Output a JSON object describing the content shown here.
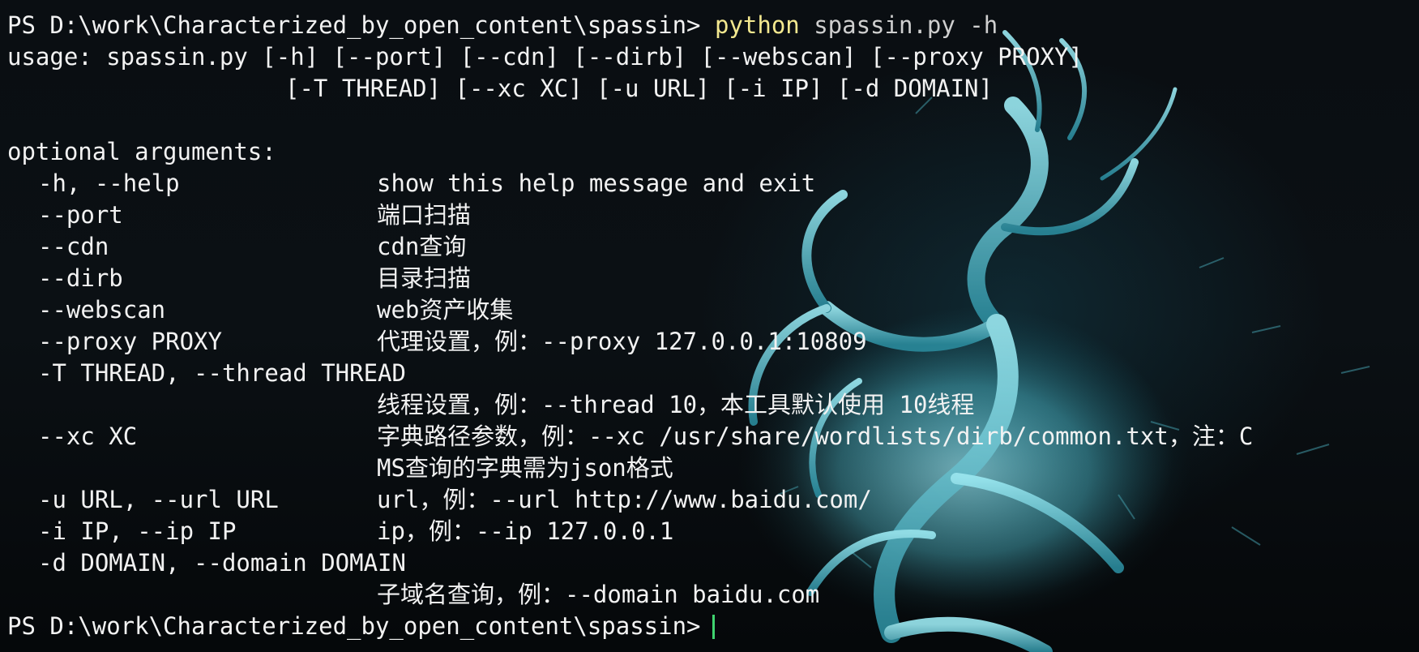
{
  "terminal": {
    "prompt_path": "PS D:\\work\\Characterized_by_open_content\\spassin>",
    "command": "python",
    "command_args": "spassin.py -h",
    "usage_line1": "usage: spassin.py [-h] [--port] [--cdn] [--dirb] [--webscan] [--proxy PROXY]",
    "usage_line2": "[-T THREAD] [--xc XC] [-u URL] [-i IP] [-d DOMAIN]",
    "section_title": "optional arguments:",
    "options": [
      {
        "name": "-h, --help",
        "desc": "show this help message and exit"
      },
      {
        "name": "--port",
        "desc": "端口扫描"
      },
      {
        "name": "--cdn",
        "desc": "cdn查询"
      },
      {
        "name": "--dirb",
        "desc": "目录扫描"
      },
      {
        "name": "--webscan",
        "desc": "web资产收集"
      },
      {
        "name": "--proxy PROXY",
        "desc": "代理设置，例：--proxy 127.0.0.1:10809"
      },
      {
        "name": "-T THREAD, --thread THREAD",
        "desc": ""
      },
      {
        "name": "",
        "desc": "线程设置，例：--thread 10，本工具默认使用 10线程"
      },
      {
        "name": "--xc XC",
        "desc": "字典路径参数，例：--xc /usr/share/wordlists/dirb/common.txt，注：C"
      },
      {
        "name": "",
        "desc": "MS查询的字典需为json格式"
      },
      {
        "name": "-u URL, --url URL",
        "desc": "url，例：--url http://www.baidu.com/"
      },
      {
        "name": "-i IP, --ip IP",
        "desc": "ip，例：--ip 127.0.0.1"
      },
      {
        "name": "-d DOMAIN, --domain DOMAIN",
        "desc": ""
      },
      {
        "name": "",
        "desc": "子域名查询，例：--domain baidu.com"
      }
    ],
    "final_prompt": "PS D:\\work\\Characterized_by_open_content\\spassin>"
  },
  "colors": {
    "text": "#f2f2f2",
    "command": "#f3e88f",
    "args": "#cfcfcf",
    "cursor": "#3fd36f",
    "background": "#06090c",
    "dragon": "#7fe3ec"
  },
  "icons": {
    "wallpaper": "dragon-wallpaper-icon"
  }
}
